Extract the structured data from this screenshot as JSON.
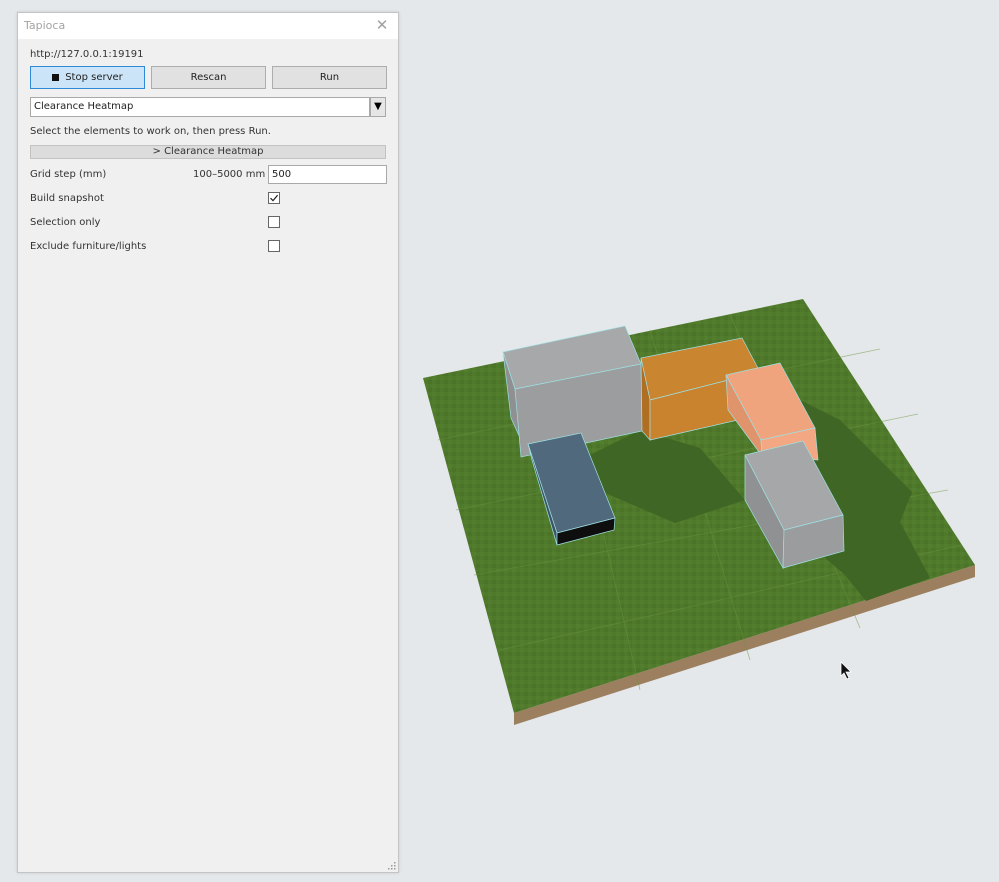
{
  "panel": {
    "title": "Tapioca",
    "server_url": "http://127.0.0.1:19191",
    "buttons": {
      "stop_server": "Stop server",
      "rescan": "Rescan",
      "run": "Run"
    },
    "tool_select": {
      "selected": "Clearance Heatmap"
    },
    "instruction": "Select the elements to work on, then press Run.",
    "section_header": "> Clearance Heatmap",
    "grid_step": {
      "label": "Grid step (mm)",
      "range": "100–5000 mm",
      "value": "500"
    },
    "options": [
      {
        "label": "Build snapshot",
        "checked": true
      },
      {
        "label": "Selection only",
        "checked": false
      },
      {
        "label": "Exclude furniture/lights",
        "checked": false
      }
    ]
  },
  "icons": {
    "close": "close-icon",
    "stop": "stop-icon",
    "dropdown": "chevron-down-icon",
    "checkmark": "checkmark-icon",
    "cursor": "mouse-pointer-icon",
    "resize": "resize-grip-icon"
  },
  "colors": {
    "primary_button": "#cce4f7",
    "ground": "#4f7a2b",
    "ground_side": "#9c7f5e",
    "building_gray": "#9b9d9e",
    "building_orange": "#c9822e",
    "building_peach": "#f0a47e",
    "building_blue": "#4f687a"
  }
}
